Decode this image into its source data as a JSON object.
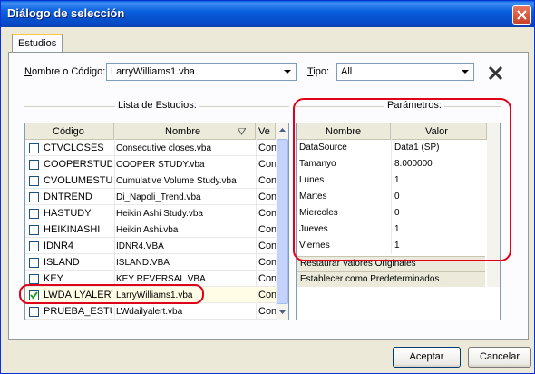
{
  "window": {
    "title": "Diálogo de selección"
  },
  "tabs": [
    {
      "label": "Estudios"
    }
  ],
  "filters": {
    "name_label_prefix": "N",
    "name_label_rest": "ombre o Código:",
    "name_value": "LarryWilliams1.vba",
    "type_label_prefix": "T",
    "type_label_rest": "ipo:",
    "type_value": "All"
  },
  "study_list": {
    "title": "Lista de Estudios:",
    "columns": [
      "Código",
      "Nombre",
      "Ve"
    ],
    "rows": [
      {
        "code": "CTVCLOSES",
        "name": "Consecutive closes.vba",
        "ver": "Con",
        "checked": false
      },
      {
        "code": "COOPERSTUDY",
        "name": "COOPER STUDY.vba",
        "ver": "Con",
        "checked": false
      },
      {
        "code": "CVOLUMESTUDY",
        "name": "Cumulative Volume Study.vba",
        "ver": "Con",
        "checked": false
      },
      {
        "code": "DNTREND",
        "name": "Di_Napoli_Trend.vba",
        "ver": "Con",
        "checked": false
      },
      {
        "code": "HASTUDY",
        "name": "Heikin Ashi Study.vba",
        "ver": "Con",
        "checked": false
      },
      {
        "code": "HEIKINASHI",
        "name": "Heikin Ashi.vba",
        "ver": "Con",
        "checked": false
      },
      {
        "code": "IDNR4",
        "name": "IDNR4.VBA",
        "ver": "Con",
        "checked": false
      },
      {
        "code": "ISLAND",
        "name": "ISLAND.VBA",
        "ver": "Con",
        "checked": false
      },
      {
        "code": "KEY",
        "name": "KEY REVERSAL.VBA",
        "ver": "Con",
        "checked": false
      },
      {
        "code": "LWDAILYALERT",
        "name": "LarryWilliams1.vba",
        "ver": "Con",
        "checked": true
      },
      {
        "code": "PRUEBA_ESTUD",
        "name": "LWdailyalert.vba",
        "ver": "Con",
        "checked": false
      }
    ]
  },
  "parameters": {
    "title": "Parámetros:",
    "columns": [
      "Nombre",
      "Valor"
    ],
    "rows": [
      {
        "name": "DataSource",
        "value": "Data1 (SP)"
      },
      {
        "name": "Tamanyo",
        "value": "8.000000"
      },
      {
        "name": "Lunes",
        "value": "1"
      },
      {
        "name": "Martes",
        "value": "0"
      },
      {
        "name": "Miercoles",
        "value": "0"
      },
      {
        "name": "Jueves",
        "value": "1"
      },
      {
        "name": "Viernes",
        "value": "1"
      }
    ],
    "restore_label": "Restaurar Valores Originales",
    "default_label": "Establecer como Predeterminados"
  },
  "buttons": {
    "accept": "Aceptar",
    "cancel": "Cancelar"
  },
  "colors": {
    "annotation": "#e0001a",
    "title_bar": "#0a5fdc"
  }
}
